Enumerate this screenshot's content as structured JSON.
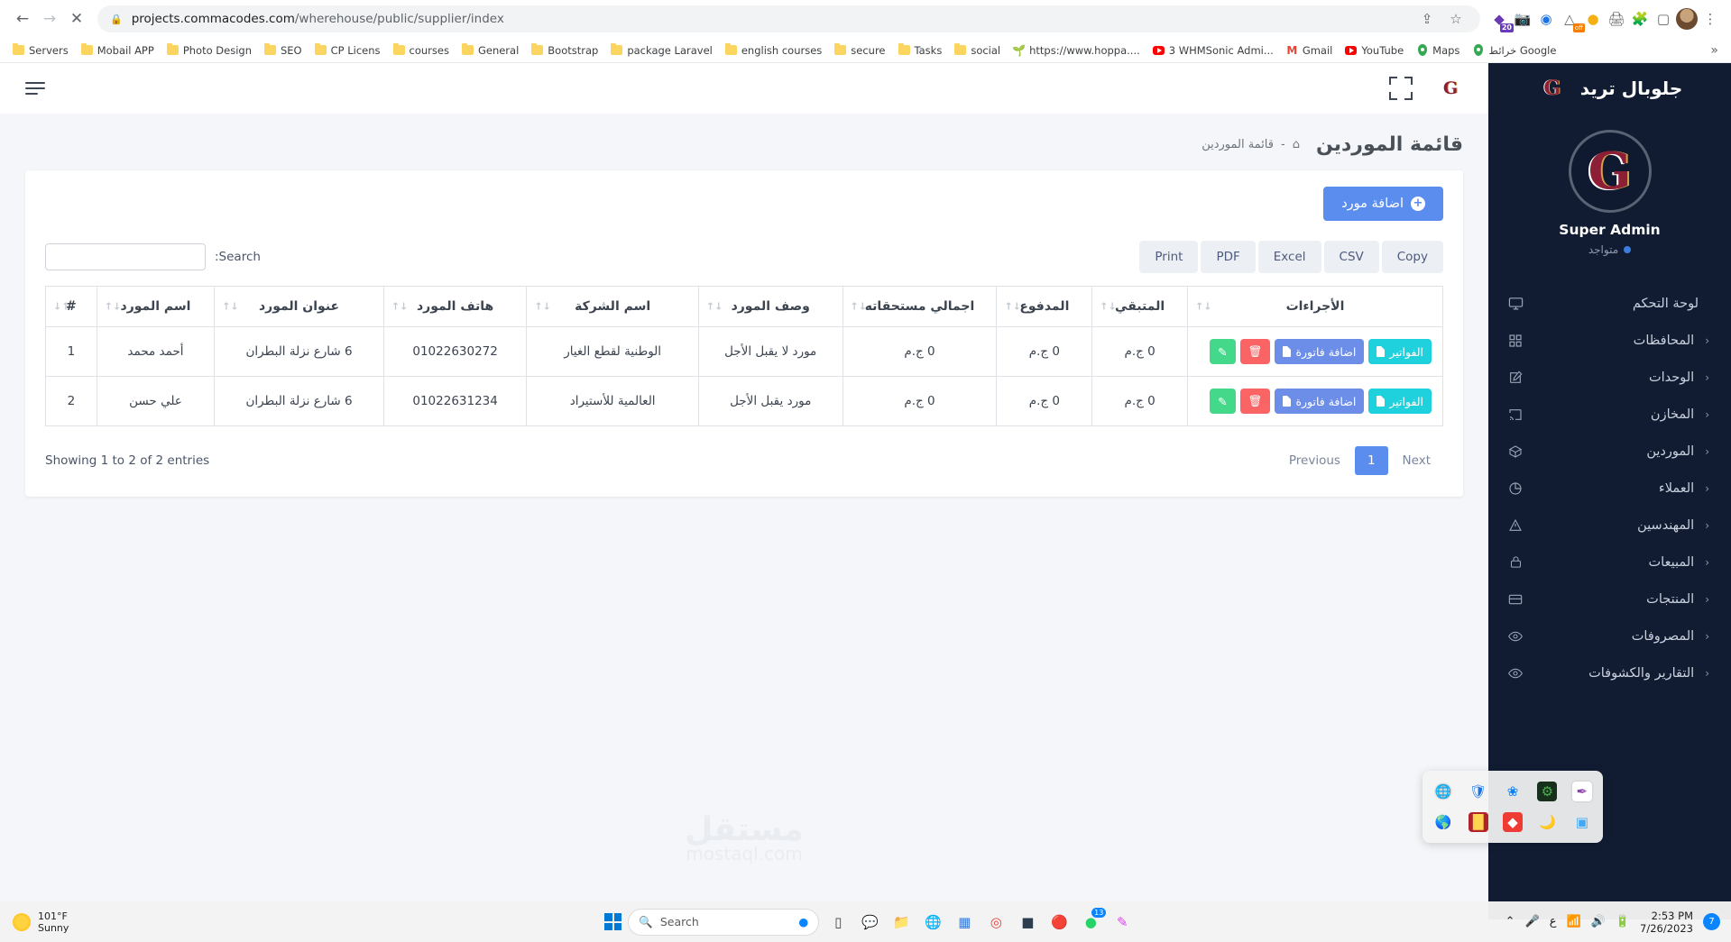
{
  "browser": {
    "url_prefix": "projects.commacodes.com",
    "url_path": "/wherehouse/public/supplier/index",
    "back_label": "←",
    "forward_label": "→",
    "stop_label": "✕",
    "lock_icon": "lock-icon",
    "share_label": "⇪",
    "star_label": "☆",
    "ext_badge": "20",
    "ext_off": "off",
    "overflow_label": "»",
    "menu_label": "⋮",
    "bookmarks": [
      {
        "label": "Servers",
        "icon": "folder"
      },
      {
        "label": "Mobail APP",
        "icon": "folder"
      },
      {
        "label": "Photo Design",
        "icon": "folder"
      },
      {
        "label": "SEO",
        "icon": "folder"
      },
      {
        "label": "CP Licens",
        "icon": "folder"
      },
      {
        "label": "courses",
        "icon": "folder"
      },
      {
        "label": "General",
        "icon": "folder"
      },
      {
        "label": "Bootstrap",
        "icon": "folder"
      },
      {
        "label": "package Laravel",
        "icon": "folder"
      },
      {
        "label": "english courses",
        "icon": "folder"
      },
      {
        "label": "secure",
        "icon": "folder"
      },
      {
        "label": "Tasks",
        "icon": "folder"
      },
      {
        "label": "social",
        "icon": "folder"
      },
      {
        "label": "https://www.hoppa....",
        "icon": "hoppscotch"
      },
      {
        "label": "3 WHMSonic Admi...",
        "icon": "youtube"
      },
      {
        "label": "Gmail",
        "icon": "gmail"
      },
      {
        "label": "YouTube",
        "icon": "youtube"
      },
      {
        "label": "Maps",
        "icon": "maps"
      },
      {
        "label": "خرائط Google",
        "icon": "maps"
      }
    ]
  },
  "sidebar": {
    "brand": "جلوبال تريد",
    "logo_letter": "G",
    "user_name": "Super Admin",
    "status": "متواجد",
    "items": [
      {
        "label": "لوحة التحكم",
        "icon": "monitor-icon",
        "caret": ""
      },
      {
        "label": "المحافظات",
        "icon": "grid-icon",
        "caret": "‹"
      },
      {
        "label": "الوحدات",
        "icon": "edit-icon",
        "caret": "‹"
      },
      {
        "label": "المخازن",
        "icon": "cast-icon",
        "caret": "‹"
      },
      {
        "label": "الموردين",
        "icon": "box-icon",
        "caret": "‹"
      },
      {
        "label": "العملاء",
        "icon": "pie-chart-icon",
        "caret": "‹"
      },
      {
        "label": "المهندسين",
        "icon": "alert-triangle-icon",
        "caret": "‹"
      },
      {
        "label": "المبيعات",
        "icon": "lock-icon",
        "caret": "‹"
      },
      {
        "label": "المنتجات",
        "icon": "credit-card-icon",
        "caret": "‹"
      },
      {
        "label": "المصروفات",
        "icon": "eye-icon",
        "caret": "‹"
      },
      {
        "label": "التقارير والكشوفات",
        "icon": "eye-icon",
        "caret": "‹"
      }
    ]
  },
  "topbar": {
    "logo_letter": "G",
    "fullscreen_icon": "fullscreen-icon",
    "menu_icon": "hamburger-icon"
  },
  "page": {
    "title": "قائمة الموردين",
    "breadcrumb_home": "⌂",
    "breadcrumb_sep": "-",
    "breadcrumb_current": "قائمة الموردين"
  },
  "card": {
    "add_button": "اضافة مورد",
    "add_icon": "+",
    "export_buttons": [
      "Print",
      "PDF",
      "Excel",
      "CSV",
      "Copy"
    ],
    "search_label": ":Search",
    "search_value": "",
    "search_placeholder": "",
    "sort_icon": "↓↑",
    "sort_icon_first": "↑↓"
  },
  "table": {
    "headers": [
      "الأجراءات",
      "المتبقي",
      "المدفوع",
      "اجمالي مستحقاته",
      "وصف المورد",
      "اسم الشركة",
      "هاتف المورد",
      "عنوان المورد",
      "اسم المورد",
      "#"
    ],
    "rows": [
      {
        "id": "1",
        "supplier_name": "أحمد محمد",
        "address": "6 شارع نزلة البطران",
        "phone": "01022630272",
        "company": "الوطنية لقطع الغيار",
        "description": "مورد لا يقبل الأجل",
        "total_due": "0 ج.م",
        "paid": "0 ج.م",
        "remaining": "0 ج.م"
      },
      {
        "id": "2",
        "supplier_name": "علي حسن",
        "address": "6 شارع نزلة البطران",
        "phone": "01022631234",
        "company": "العالمية للأستيراد",
        "description": "مورد يقبل الأجل",
        "total_due": "0 ج.م",
        "paid": "0 ج.م",
        "remaining": "0 ج.م"
      }
    ],
    "actions": {
      "invoices": "الفواتير",
      "add_invoice": "اضافة فاتورة",
      "delete_icon": "🗑",
      "edit_icon": "✎"
    }
  },
  "footer": {
    "showing": "Showing 1 to 2 of 2 entries",
    "previous": "Previous",
    "page_number": "1",
    "next": "Next"
  },
  "watermark": {
    "arabic": "مستقل",
    "latin": "mostaql.com"
  },
  "tray": {
    "icons_row1": [
      "globe-icon",
      "security-shield-icon",
      "bluetooth-icon",
      "network-settings-icon",
      "onenote-feather-icon"
    ],
    "icons_row2": [
      "photoshop-globe-icon",
      "red-app-icon",
      "teamviewer-icon",
      "moon-browser-icon",
      "blue-window-icon"
    ]
  },
  "taskbar": {
    "weather_temp": "101°F",
    "weather_desc": "Sunny",
    "search_placeholder": "Search",
    "apps": [
      "task-view-icon",
      "chat-icon",
      "file-explorer-icon",
      "edge-icon",
      "store-icon",
      "chrome-icon",
      "app-icon",
      "firefox-icon",
      "whatsapp-icon",
      "editor-icon"
    ],
    "whatsapp_count": "13",
    "lang": "ع",
    "chevron": "⌃",
    "mic_icon": "mic-icon",
    "wifi_icon": "wifi-icon",
    "volume_icon": "volume-icon",
    "battery_icon": "battery-icon",
    "time": "2:53 PM",
    "date": "7/26/2023",
    "notif_count": "7"
  },
  "colors": {
    "accent_blue": "#5b8def",
    "sidebar_bg": "#111c33",
    "cyan": "#1fd0dd",
    "red": "#fa6464",
    "green": "#44d98a"
  }
}
